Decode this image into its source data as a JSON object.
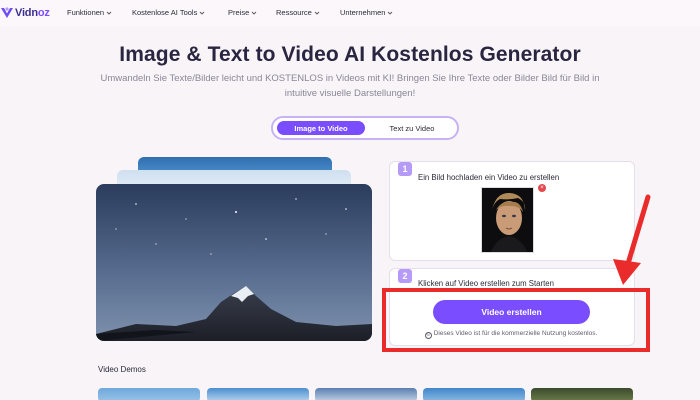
{
  "header": {
    "logo_text_main": "Vidn",
    "logo_text_accent": "oz",
    "nav": [
      {
        "label": "Funktionen"
      },
      {
        "label": "Kostenlose AI Tools"
      },
      {
        "label": "Preise"
      },
      {
        "label": "Ressource"
      },
      {
        "label": "Unternehmen"
      }
    ]
  },
  "hero": {
    "title": "Image & Text to Video AI Kostenlos Generator",
    "subtitle": "Umwandeln Sie Texte/Bilder leicht und KOSTENLOS in Videos mit KI! Bringen Sie Ihre Texte oder Bilder Bild für Bild in intuitive visuelle Darstellungen!"
  },
  "mode_toggle": {
    "active": "Image to Video",
    "inactive": "Text zu Video"
  },
  "steps": [
    {
      "number": "1",
      "text": "Ein Bild hochladen ein Video zu erstellen"
    },
    {
      "number": "2",
      "text": "Klicken auf Video erstellen zum Starten"
    }
  ],
  "cta": {
    "label": "Video erstellen",
    "note_icon": "©",
    "note": "Dieses Video ist für die kommerzielle Nutzung kostenlos."
  },
  "demos": {
    "title": "Video Demos"
  },
  "colors": {
    "accent": "#7a4dff",
    "highlight": "#ea2b2b",
    "step_badge": "#b69af7"
  },
  "icons": [
    "vidnoz-logo-icon",
    "chevron-down-icon",
    "remove-icon",
    "info-icon",
    "red-arrow-icon"
  ]
}
